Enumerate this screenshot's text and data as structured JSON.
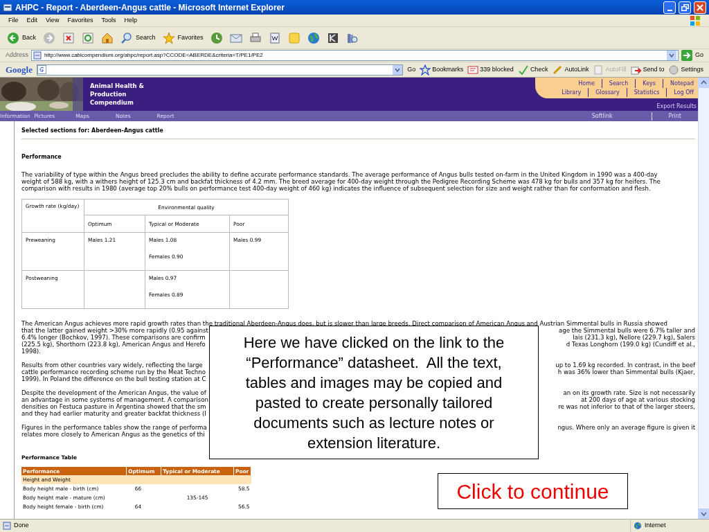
{
  "window": {
    "title": "AHPC - Report - Aberdeen-Angus cattle - Microsoft Internet Explorer"
  },
  "menu": [
    "File",
    "Edit",
    "View",
    "Favorites",
    "Tools",
    "Help"
  ],
  "toolbar": [
    {
      "kind": "back",
      "label": "Back"
    },
    {
      "kind": "forward"
    },
    {
      "kind": "stop"
    },
    {
      "kind": "refresh"
    },
    {
      "kind": "home"
    },
    {
      "kind": "search",
      "label": "Search"
    },
    {
      "kind": "favorites",
      "label": "Favorites"
    },
    {
      "kind": "history"
    },
    {
      "kind": "mail"
    },
    {
      "kind": "print"
    },
    {
      "kind": "word"
    },
    {
      "kind": "note"
    },
    {
      "kind": "globe"
    },
    {
      "kind": "messenger"
    },
    {
      "kind": "research"
    }
  ],
  "address": {
    "label": "Address",
    "url": "http://www.cabicompendium.org/ahpc/report.asp?CCODE=ABERDE&criteria=T/PE1/PE2",
    "go": "Go"
  },
  "google_bar": {
    "logo": "Google",
    "go": "Go",
    "items": [
      {
        "label": "Bookmarks",
        "disabled": false
      },
      {
        "label": "339 blocked",
        "disabled": false
      },
      {
        "label": "Check",
        "disabled": false
      },
      {
        "label": "AutoLink",
        "disabled": false
      },
      {
        "label": "AutoFill",
        "disabled": true
      },
      {
        "label": "Send to",
        "disabled": false
      },
      {
        "label": "Settings",
        "disabled": false
      }
    ]
  },
  "site": {
    "title_lines": [
      "Animal Health &",
      "Production",
      "Compendium"
    ],
    "top_links": [
      [
        "Home",
        "Search",
        "Keys",
        "Notepad"
      ],
      [
        "Library",
        "Glossary",
        "Statistics",
        "Log Off"
      ]
    ],
    "export": "Export Results",
    "nav": [
      "Information",
      "Pictures",
      "Maps",
      "Notes",
      "Report"
    ],
    "nav_right": [
      "Softlink",
      "Print"
    ]
  },
  "content": {
    "heading": "Selected sections for: Aberdeen-Angus cattle",
    "section": "Performance",
    "intro": [
      "The variability of type within the Angus breed precludes the ability to define accurate performance standards. The average performance of Angus bulls tested on-farm in the United Kingdom in 1990 was a 400-day",
      "weight of 588 kg, with a withers height of 125.3 cm and backfat thickness of 4.2 mm. The breed average for 400-day weight through the Pedigree Recording Scheme was 478 kg for bulls and 357 kg for heifers. The",
      "comparison with results in 1980 (average top 20% bulls on performance test 400-day weight of 460 kg) indicates the influence of subsequent selection for size and weight rather than for conformation and flesh."
    ],
    "growth_table": {
      "row_header": "Growth rate (kg/day)",
      "group_header": "Environmental quality",
      "columns": [
        "Optimum",
        "Typical or Moderate",
        "Poor"
      ],
      "rows": [
        {
          "label": "Preweaning",
          "cells": [
            [
              "Males 1.21"
            ],
            [
              "Males 1.08",
              "Females 0.90"
            ],
            [
              "Males 0.99"
            ]
          ]
        },
        {
          "label": "Postweaning",
          "cells": [
            [],
            [
              "Males 0.97",
              "Females 0.89"
            ],
            []
          ]
        }
      ]
    },
    "paragraphs": [
      [
        {
          "left": "The American Angus achieves more rapid growth rates than the traditional Aberdeen-Angus does, but is slower than large breeds. Direct comparison of American Angus and Austrian Simmental bulls in Russia showed"
        },
        {
          "left": "that the latter gained weight >30% more rapidly (0.95 against",
          "right": "age the Simmental bulls were 6.7% taller and"
        },
        {
          "left": "6.4% longer (Bochkov, 1997). These comparisons are confirm",
          "right": "lais (231.3 kg), Nellore (229.7 kg), Salers"
        },
        {
          "left": "(225.5 kg), Shorthorn (223.8 kg), American Angus and Herefo",
          "right": "d Texas Longhorn (199.0 kg) (Cundiff et al.,"
        },
        {
          "left": "1998)."
        }
      ],
      [
        {
          "left": "Results from other countries vary widely, reflecting the large",
          "right": "up to 1.69 kg recorded. In contrast, in the beef"
        },
        {
          "left": "cattle performance recording scheme run by the Meat Techno",
          "right": "h was 36% lower than Simmental bulls (Kjaer,"
        },
        {
          "left": "1999). In Poland the difference on the bull testing station at C"
        }
      ],
      [
        {
          "left": "Despite the development of the American Angus, the value of",
          "right": "an on its growth rate. Size is not necessarily"
        },
        {
          "left": "an advantage in some systems of management. A comparison",
          "right": "at 200 days of age at various stocking"
        },
        {
          "left": "densities on Festuca pasture in Argentina showed that the sm",
          "right": "re was not inferior to that of the larger steers,"
        },
        {
          "left": "and they had earlier maturity and greater backfat thickness (I"
        }
      ],
      [
        {
          "left": "Figures in the performance tables show the range of performa",
          "right": "ngus. Where only an average figure is given it"
        },
        {
          "left": "relates more closely to American Angus as the genetics of thi"
        }
      ]
    ],
    "table_title": "Performance Table",
    "perf_table": {
      "columns": [
        "Performance",
        "Optimum",
        "Typical or Moderate",
        "Poor"
      ],
      "rows": [
        {
          "kind": "group",
          "label": "Height and Weight"
        },
        {
          "kind": "data",
          "cells": [
            "Body height male - birth (cm)",
            "66",
            "",
            "58.5"
          ]
        },
        {
          "kind": "data",
          "cells": [
            "Body height male - mature (cm)",
            "",
            "135-145",
            ""
          ]
        },
        {
          "kind": "data",
          "cells": [
            "Body height female - birth (cm)",
            "64",
            "",
            "56.5"
          ]
        }
      ]
    }
  },
  "callout": "Here we have clicked on the link to the “Performance” datasheet.  All the text, tables and images may be copied and pasted to create personally tailored documents such as lecture notes or extension literature.",
  "continue_button": "Click to continue",
  "status_bar": {
    "left": "Done",
    "zone": "Internet"
  }
}
